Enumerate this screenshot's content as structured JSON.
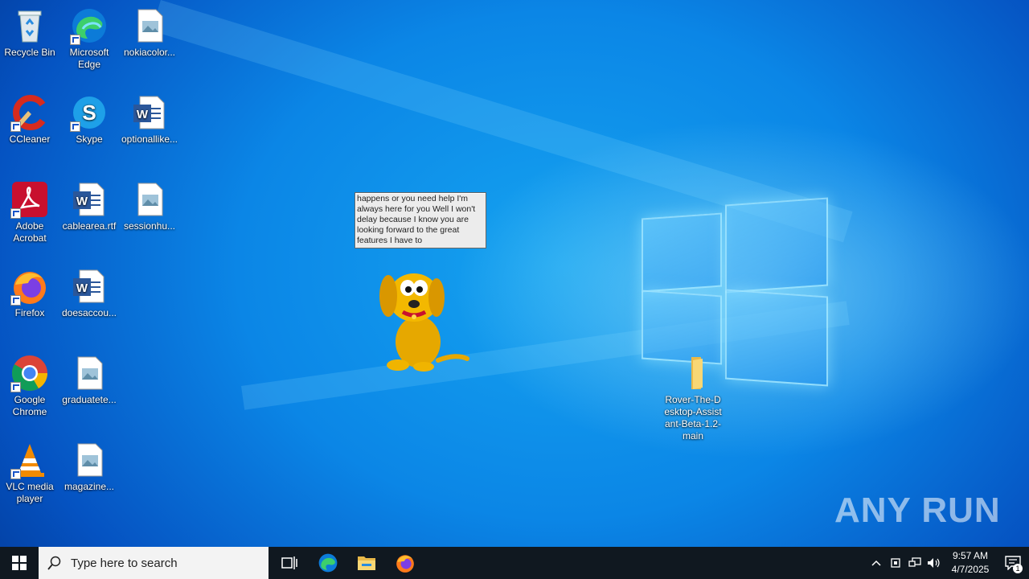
{
  "desktop": {
    "icons": [
      {
        "name": "recycle-bin",
        "label": "Recycle Bin",
        "icon": "recycle-bin-icon"
      },
      {
        "name": "microsoft-edge",
        "label": "Microsoft Edge",
        "icon": "edge-icon"
      },
      {
        "name": "nokiacolor",
        "label": "nokiacolor...",
        "icon": "image-file-icon"
      },
      {
        "name": "ccleaner",
        "label": "CCleaner",
        "icon": "ccleaner-icon"
      },
      {
        "name": "skype",
        "label": "Skype",
        "icon": "skype-icon"
      },
      {
        "name": "optionallike",
        "label": "optionallike...",
        "icon": "word-doc-icon"
      },
      {
        "name": "adobe-acrobat",
        "label": "Adobe Acrobat",
        "icon": "acrobat-icon"
      },
      {
        "name": "cablearea",
        "label": "cablearea.rtf",
        "icon": "word-doc-icon"
      },
      {
        "name": "sessionhu",
        "label": "sessionhu...",
        "icon": "image-file-icon"
      },
      {
        "name": "firefox",
        "label": "Firefox",
        "icon": "firefox-icon"
      },
      {
        "name": "doesaccou",
        "label": "doesaccou...",
        "icon": "word-doc-icon"
      },
      {
        "name": "google-chrome",
        "label": "Google Chrome",
        "icon": "chrome-icon"
      },
      {
        "name": "graduatete",
        "label": "graduatete...",
        "icon": "image-file-icon"
      },
      {
        "name": "vlc",
        "label": "VLC media player",
        "icon": "vlc-icon"
      },
      {
        "name": "magazine",
        "label": "magazine...",
        "icon": "image-file-icon"
      },
      {
        "name": "rover-folder",
        "label": "Rover-The-Desktop-Assistant-Beta-1.2-main",
        "icon": "folder-icon"
      }
    ],
    "assistant_bubble": "happens or you need help I'm always here for you Well I won't delay because I know you are looking forward to the great features I have to",
    "watermark": "ANY RUN"
  },
  "taskbar": {
    "search_placeholder": "Type here to search",
    "pinned": [
      "task-view-icon",
      "edge-icon",
      "file-explorer-icon",
      "firefox-icon"
    ],
    "clock_time": "9:57 AM",
    "clock_date": "4/7/2025",
    "notification_count": "1"
  },
  "colors": {
    "taskbar": "#101820",
    "desktop_accent": "#0b86e6"
  }
}
